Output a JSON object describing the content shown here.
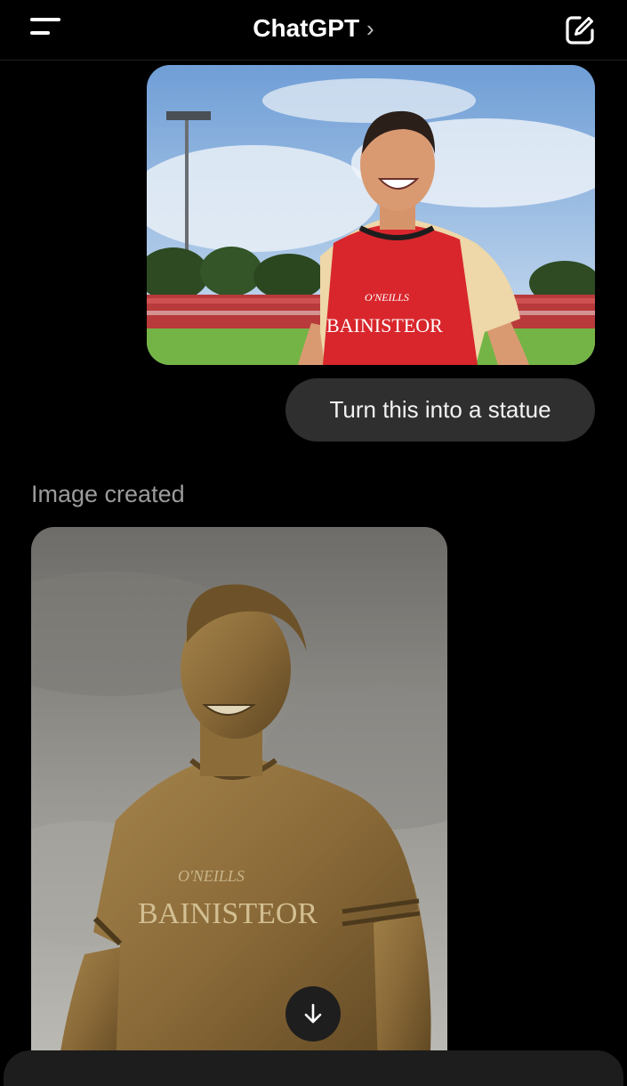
{
  "header": {
    "title": "ChatGPT",
    "chevron": "›",
    "menu_icon": "menu-icon",
    "compose_icon": "compose-icon"
  },
  "conversation": {
    "user_image": {
      "jersey_brand": "O'NEILLS",
      "jersey_text": "BAINISTEOR"
    },
    "user_message": "Turn this into a statue",
    "assistant_status": "Image created",
    "generated_image": {
      "jersey_brand": "O'NEILLS",
      "jersey_text": "BAINISTEOR"
    },
    "scroll_down_icon": "arrow-down-icon"
  },
  "colors": {
    "background": "#000000",
    "bubble": "#2f2f2f",
    "muted_text": "#9b9b9b",
    "vest_red": "#d8262c",
    "bronze": "#8a6a38"
  }
}
